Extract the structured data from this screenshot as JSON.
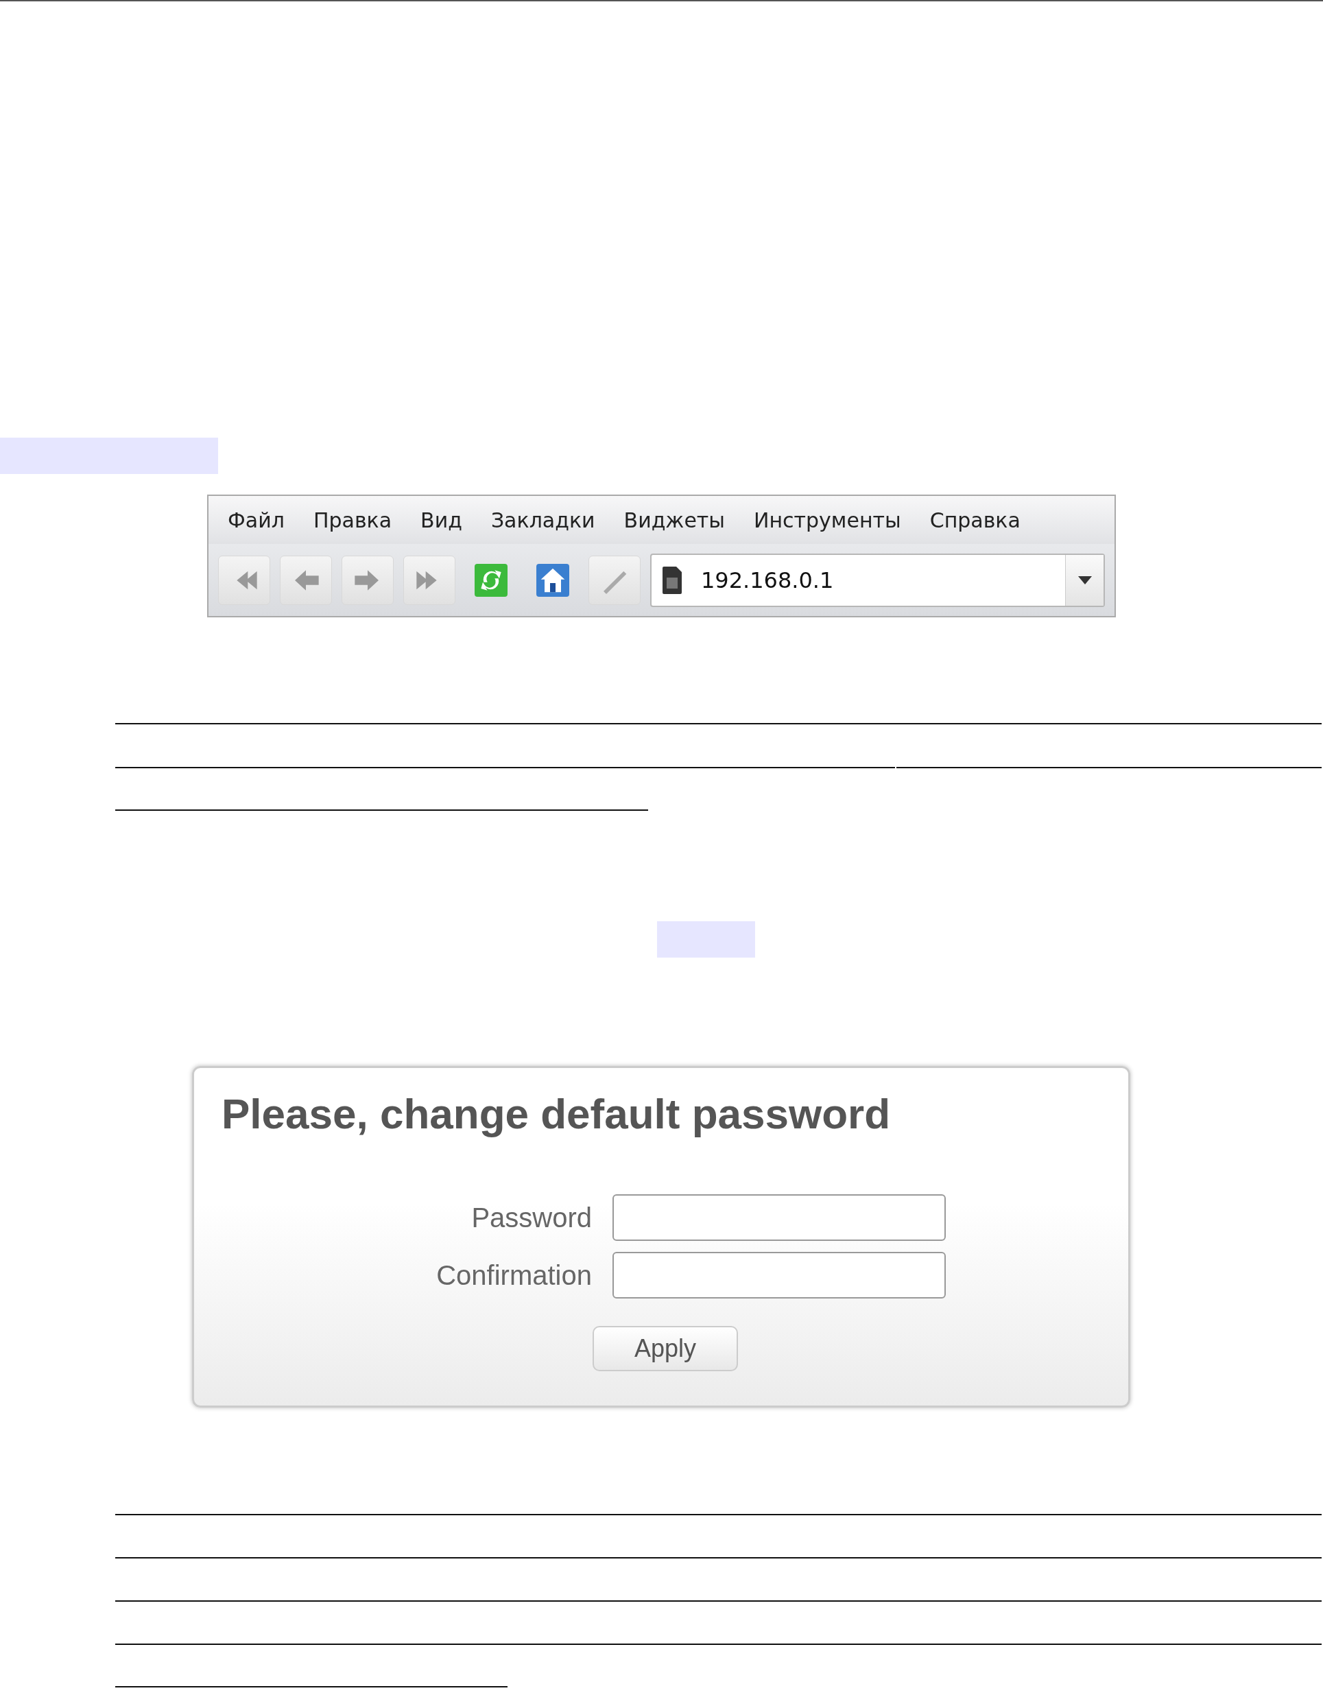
{
  "browser": {
    "menu": [
      "Файл",
      "Правка",
      "Вид",
      "Закладки",
      "Виджеты",
      "Инструменты",
      "Справка"
    ],
    "address": {
      "value": "192.168.0.1"
    }
  },
  "dialog": {
    "title": "Please, change default password",
    "fields": [
      {
        "label": "Password"
      },
      {
        "label": "Confirmation"
      }
    ],
    "button": "Apply"
  }
}
